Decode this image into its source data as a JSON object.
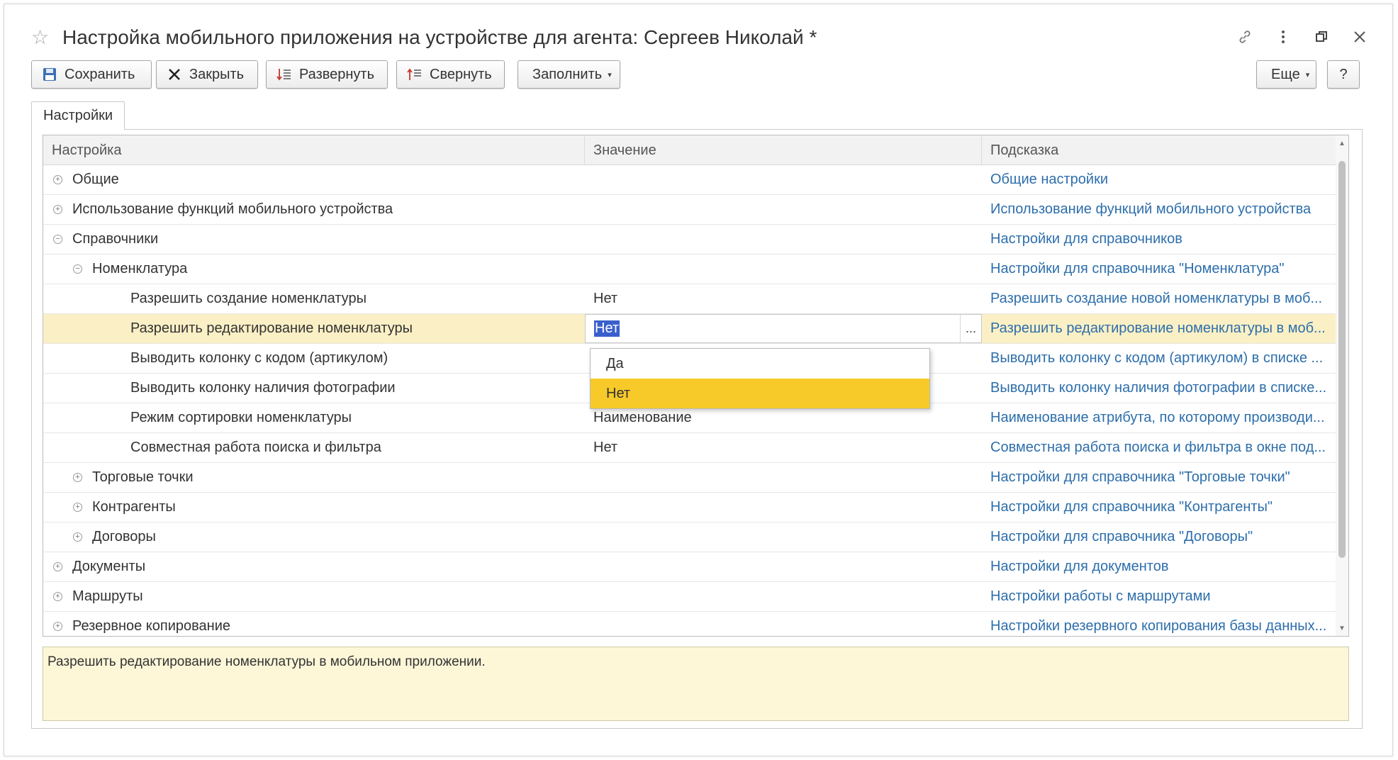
{
  "window": {
    "title": "Настройка мобильного приложения на устройстве для агента: Сергеев Николай *",
    "star_icon": "star-icon",
    "title_icons": [
      "link-icon",
      "more-vertical-icon",
      "restore-window-icon",
      "close-icon"
    ]
  },
  "toolbar": {
    "save_label": "Сохранить",
    "close_label": "Закрыть",
    "expand_label": "Развернуть",
    "collapse_label": "Свернуть",
    "fill_label": "Заполнить",
    "more_label": "Еще",
    "help_label": "?"
  },
  "tabs": [
    {
      "label": "Настройки"
    }
  ],
  "table": {
    "columns": [
      "Настройка",
      "Значение",
      "Подсказка"
    ],
    "rows": [
      {
        "name": "Общие",
        "value": "",
        "hint": "Общие настройки",
        "level": 0,
        "expander": "plus"
      },
      {
        "name": "Использование функций мобильного устройства",
        "value": "",
        "hint": "Использование функций мобильного устройства",
        "level": 0,
        "expander": "plus"
      },
      {
        "name": "Справочники",
        "value": "",
        "hint": "Настройки для справочников",
        "level": 0,
        "expander": "minus"
      },
      {
        "name": "Номенклатура",
        "value": "",
        "hint": "Настройки для справочника \"Номенклатура\"",
        "level": 1,
        "expander": "minus"
      },
      {
        "name": "Разрешить создание номенклатуры",
        "value": "Нет",
        "hint": "Разрешить создание новой номенклатуры в моб...",
        "level": 2,
        "expander": ""
      },
      {
        "name": "Разрешить редактирование номенклатуры",
        "value": "Нет",
        "hint": "Разрешить редактирование номенклатуры в моб...",
        "level": 2,
        "expander": "",
        "selected": true
      },
      {
        "name": "Выводить колонку с кодом (артикулом)",
        "value": "",
        "hint": "Выводить колонку с кодом (артикулом) в списке ...",
        "level": 2,
        "expander": ""
      },
      {
        "name": "Выводить колонку наличия фотографии",
        "value": "",
        "hint": "Выводить колонку наличия фотографии в списке...",
        "level": 2,
        "expander": ""
      },
      {
        "name": "Режим сортировки номенклатуры",
        "value": "Наименование",
        "hint": "Наименование атрибута, по которому производи...",
        "level": 2,
        "expander": ""
      },
      {
        "name": "Совместная работа поиска и фильтра",
        "value": "Нет",
        "hint": "Совместная работа поиска и фильтра в окне под...",
        "level": 2,
        "expander": ""
      },
      {
        "name": "Торговые точки",
        "value": "",
        "hint": "Настройки для справочника \"Торговые точки\"",
        "level": 1,
        "expander": "plus"
      },
      {
        "name": "Контрагенты",
        "value": "",
        "hint": "Настройки для справочника \"Контрагенты\"",
        "level": 1,
        "expander": "plus"
      },
      {
        "name": "Договоры",
        "value": "",
        "hint": "Настройки для справочника \"Договоры\"",
        "level": 1,
        "expander": "plus"
      },
      {
        "name": "Документы",
        "value": "",
        "hint": "Настройки для документов",
        "level": 0,
        "expander": "plus"
      },
      {
        "name": "Маршруты",
        "value": "",
        "hint": "Настройки работы с маршрутами",
        "level": 0,
        "expander": "plus"
      },
      {
        "name": "Резервное копирование",
        "value": "",
        "hint": "Настройки резервного копирования базы данных...",
        "level": 0,
        "expander": "plus"
      }
    ]
  },
  "editor": {
    "value": "Нет",
    "button": "..."
  },
  "dropdown": {
    "options": [
      "Да",
      "Нет"
    ],
    "selected": "Нет"
  },
  "hint_box": {
    "text": "Разрешить редактирование номенклатуры в мобильном приложении."
  },
  "colors": {
    "link": "#2d6eab",
    "selected_row": "#fbf0c5",
    "dropdown_active": "#f7ca2a",
    "hint_bg": "#fdf7d8"
  }
}
